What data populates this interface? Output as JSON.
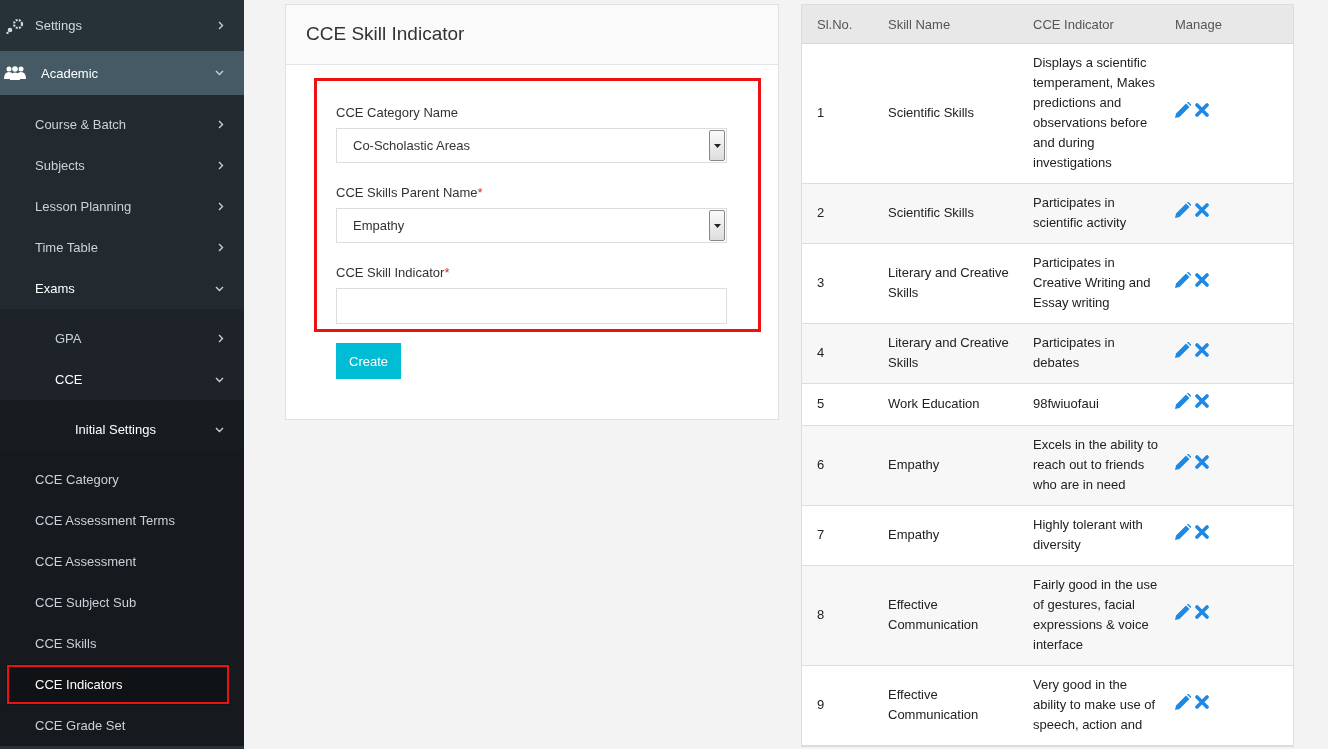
{
  "sidebar": {
    "items": [
      {
        "label": "Settings",
        "expanded": false
      },
      {
        "label": "Academic",
        "expanded": true,
        "children": [
          {
            "label": "Course & Batch",
            "expanded": false,
            "selected": false
          },
          {
            "label": "Subjects",
            "expanded": false,
            "selected": false
          },
          {
            "label": "Lesson Planning",
            "expanded": false,
            "selected": false
          },
          {
            "label": "Time Table",
            "expanded": false,
            "selected": false
          },
          {
            "label": "Exams",
            "expanded": true,
            "selected": false,
            "children": [
              {
                "label": "GPA",
                "expanded": false,
                "selected": false
              },
              {
                "label": "CCE",
                "expanded": true,
                "selected": false,
                "children": [
                  {
                    "label": "Initial Settings",
                    "expanded": true,
                    "selected": false,
                    "children": [
                      {
                        "label": "CCE Category",
                        "selected": false
                      },
                      {
                        "label": "CCE Assessment Terms",
                        "selected": false
                      },
                      {
                        "label": "CCE Assessment",
                        "selected": false
                      },
                      {
                        "label": "CCE Subject Sub",
                        "selected": false
                      },
                      {
                        "label": "CCE Skills",
                        "selected": false
                      },
                      {
                        "label": "CCE Indicators",
                        "selected": true
                      },
                      {
                        "label": "CCE Grade Set",
                        "selected": false
                      }
                    ]
                  }
                ]
              }
            ]
          }
        ]
      }
    ]
  },
  "form": {
    "title": "CCE Skill Indicator",
    "fields": [
      {
        "kind": "select",
        "label": "CCE Category Name",
        "value": "Co-Scholastic Areas"
      },
      {
        "kind": "select",
        "label": "CCE Skills Parent Name",
        "required_mark": "*",
        "value": "Empathy"
      },
      {
        "kind": "text",
        "label": "CCE Skill Indicator",
        "required_mark": "*"
      }
    ],
    "submit": "Create"
  },
  "table": {
    "columns": [
      "Sl.No.",
      "Skill Name",
      "CCE Indicator",
      "Manage"
    ],
    "rows": [
      {
        "no": "1",
        "skill": "Scientific Skills",
        "indicator": "Displays a scientific temperament, Makes predictions and observations before and during investigations"
      },
      {
        "no": "2",
        "skill": "Scientific Skills",
        "indicator": "Participates in scientific activity"
      },
      {
        "no": "3",
        "skill": "Literary and Creative Skills",
        "indicator": "Participates in Creative Writing and Essay writing"
      },
      {
        "no": "4",
        "skill": "Literary and Creative Skills",
        "indicator": "Participates in debates"
      },
      {
        "no": "5",
        "skill": "Work Education",
        "indicator": "98fwiuofaui"
      },
      {
        "no": "6",
        "skill": "Empathy",
        "indicator": "Excels in the ability to reach out to friends who are in need"
      },
      {
        "no": "7",
        "skill": "Empathy",
        "indicator": "Highly tolerant with diversity"
      },
      {
        "no": "8",
        "skill": "Effective Communication",
        "indicator": "Fairly good in the use of gestures, facial expressions & voice interface"
      },
      {
        "no": "9",
        "skill": "Effective Communication",
        "indicator": "Very good in the ability to make use of speech, action and"
      }
    ]
  }
}
